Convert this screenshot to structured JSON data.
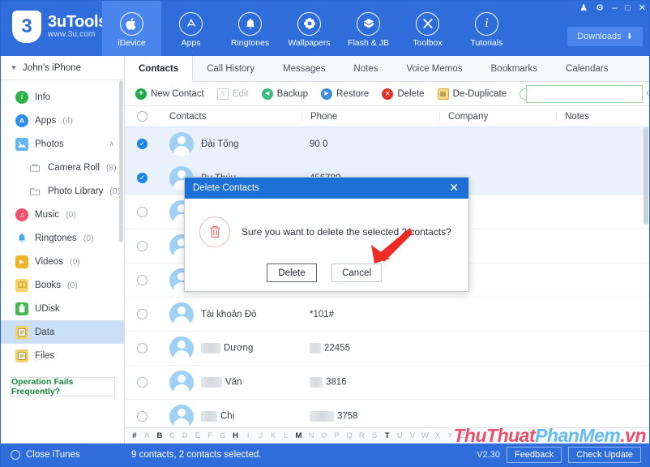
{
  "window": {
    "controls": [
      {
        "name": "skin-icon",
        "glyph": "♟"
      },
      {
        "name": "settings-gear-icon",
        "glyph": "⚙"
      },
      {
        "name": "minimize-icon",
        "glyph": "–"
      },
      {
        "name": "maximize-icon",
        "glyph": "□"
      },
      {
        "name": "close-icon",
        "glyph": "✕"
      }
    ]
  },
  "brand": {
    "mark": "3",
    "name": "3uTools",
    "url": "www.3u.com"
  },
  "topnav": {
    "items": [
      {
        "label": "iDevice",
        "icon": "apple-icon",
        "glyph": "",
        "active": true
      },
      {
        "label": "Apps",
        "icon": "appstore-icon",
        "glyph": "A",
        "active": false
      },
      {
        "label": "Ringtones",
        "icon": "bell-icon",
        "glyph": "🔔",
        "active": false
      },
      {
        "label": "Wallpapers",
        "icon": "flower-icon",
        "glyph": "✿",
        "active": false
      },
      {
        "label": "Flash & JB",
        "icon": "box-icon",
        "glyph": "⬇",
        "active": false
      },
      {
        "label": "Toolbox",
        "icon": "wrench-icon",
        "glyph": "⚒",
        "active": false
      },
      {
        "label": "Tutorials",
        "icon": "info-icon",
        "glyph": "i",
        "active": false
      }
    ],
    "downloads_label": "Downloads",
    "downloads_glyph": "⬇"
  },
  "sidebar": {
    "device": "John’s iPhone",
    "items": [
      {
        "label": "Info",
        "count": "",
        "icon": "info-icon",
        "glyph": "i",
        "color": "#2cb34a",
        "shape": "circle",
        "indent": 0,
        "selected": false,
        "chevron": ""
      },
      {
        "label": "Apps",
        "count": "(4)",
        "icon": "appstore-icon",
        "glyph": "A",
        "color": "#2f8ced",
        "shape": "circle",
        "indent": 0,
        "selected": false,
        "chevron": ""
      },
      {
        "label": "Photos",
        "count": "",
        "icon": "photos-icon",
        "glyph": "🏔",
        "color": "#64b5f6",
        "shape": "square",
        "indent": 0,
        "selected": false,
        "chevron": "∧"
      },
      {
        "label": "Camera Roll",
        "count": "(8)",
        "icon": "camera-roll-icon",
        "glyph": "□",
        "color": "#8a919b",
        "shape": "outline",
        "indent": 1,
        "selected": false,
        "chevron": ""
      },
      {
        "label": "Photo Library",
        "count": "(0)",
        "icon": "folder-icon",
        "glyph": "□",
        "color": "#8a919b",
        "shape": "outline",
        "indent": 1,
        "selected": false,
        "chevron": ""
      },
      {
        "label": "Music",
        "count": "(0)",
        "icon": "music-icon",
        "glyph": "♫",
        "color": "#f2506e",
        "shape": "circle",
        "indent": 0,
        "selected": false,
        "chevron": ""
      },
      {
        "label": "Ringtones",
        "count": "(0)",
        "icon": "bell-icon",
        "glyph": "🔔",
        "color": "#4aa8f0",
        "shape": "plain",
        "indent": 0,
        "selected": false,
        "chevron": ""
      },
      {
        "label": "Videos",
        "count": "(0)",
        "icon": "video-icon",
        "glyph": "▶",
        "color": "#f0b429",
        "shape": "square",
        "indent": 0,
        "selected": false,
        "chevron": ""
      },
      {
        "label": "Books",
        "count": "(0)",
        "icon": "books-icon",
        "glyph": "📖",
        "color": "#f5d26a",
        "shape": "square",
        "indent": 0,
        "selected": false,
        "chevron": ""
      },
      {
        "label": "UDisk",
        "count": "",
        "icon": "usb-icon",
        "glyph": "⚡",
        "color": "#3fb950",
        "shape": "square",
        "indent": 0,
        "selected": false,
        "chevron": ""
      },
      {
        "label": "Data",
        "count": "",
        "icon": "data-icon",
        "glyph": "☰",
        "color": "#f3cf6b",
        "shape": "square",
        "indent": 0,
        "selected": true,
        "chevron": ""
      },
      {
        "label": "Files",
        "count": "",
        "icon": "files-icon",
        "glyph": "☰",
        "color": "#f3cf6b",
        "shape": "square",
        "indent": 0,
        "selected": false,
        "chevron": ""
      }
    ],
    "operation_fails": "Operation Fails Frequently?"
  },
  "tabs": [
    {
      "label": "Contacts",
      "active": true
    },
    {
      "label": "Call History",
      "active": false
    },
    {
      "label": "Messages",
      "active": false
    },
    {
      "label": "Notes",
      "active": false
    },
    {
      "label": "Voice Memos",
      "active": false
    },
    {
      "label": "Bookmarks",
      "active": false
    },
    {
      "label": "Calendars",
      "active": false
    }
  ],
  "toolbar": {
    "buttons": [
      {
        "label": "New Contact",
        "icon": "plus-circle-icon",
        "glyph": "+",
        "color": "#23a94d",
        "shape": "circle",
        "disabled": false
      },
      {
        "label": "Edit",
        "icon": "pencil-icon",
        "glyph": "✎",
        "color": "#c3c8cf",
        "shape": "square",
        "disabled": true
      },
      {
        "label": "Backup",
        "icon": "backup-icon",
        "glyph": "◀",
        "color": "#3cba7d",
        "shape": "circle",
        "disabled": false
      },
      {
        "label": "Restore",
        "icon": "restore-icon",
        "glyph": "▶",
        "color": "#3f8ee0",
        "shape": "circle",
        "disabled": false
      },
      {
        "label": "Delete",
        "icon": "delete-icon",
        "glyph": "✕",
        "color": "#e0352f",
        "shape": "circle",
        "disabled": false
      },
      {
        "label": "De-Duplicate",
        "icon": "deduplicate-icon",
        "glyph": "▤",
        "color": "#f0c44a",
        "shape": "square",
        "disabled": false
      },
      {
        "label": "Refresh",
        "icon": "refresh-icon",
        "glyph": "↻",
        "color": "#8bd4a4",
        "shape": "circle",
        "disabled": false
      }
    ],
    "search_placeholder": "",
    "search_value": "",
    "search_icon": "magnifier-icon"
  },
  "table": {
    "columns": [
      "Contacts",
      "Phone",
      "Company",
      "Notes"
    ],
    "rows": [
      {
        "name": "Đài Tống",
        "name_blur": 0,
        "phone": "90 0",
        "phone_blur": 0,
        "company": "",
        "notes": "",
        "checked": true
      },
      {
        "name": "Bụ Thúy",
        "name_blur": 0,
        "phone": "456789",
        "phone_blur": 0,
        "company": "",
        "notes": "",
        "checked": true
      },
      {
        "name": "",
        "name_blur": 0,
        "phone": "",
        "phone_blur": 0,
        "company": "",
        "notes": "",
        "checked": false
      },
      {
        "name": "",
        "name_blur": 0,
        "phone": "",
        "phone_blur": 0,
        "company": "",
        "notes": "",
        "checked": false
      },
      {
        "name": "",
        "name_blur": 0,
        "phone": "",
        "phone_blur": 0,
        "company": "",
        "notes": "",
        "checked": false
      },
      {
        "name": "Tài khoản Đỏ",
        "name_blur": 0,
        "phone": "*101#",
        "phone_blur": 0,
        "company": "",
        "notes": "",
        "checked": false
      },
      {
        "name": "Dương",
        "name_blur": 24,
        "phone": "22455",
        "phone_blur": 14,
        "company": "",
        "notes": "",
        "checked": false
      },
      {
        "name": "Văn",
        "name_blur": 26,
        "phone": "3816",
        "phone_blur": 16,
        "company": "",
        "notes": "",
        "checked": false
      },
      {
        "name": "Chị",
        "name_blur": 20,
        "phone": "3758",
        "phone_blur": 30,
        "company": "",
        "notes": "",
        "checked": false
      }
    ]
  },
  "alphabet": {
    "letters": [
      "#",
      "A",
      "B",
      "C",
      "D",
      "E",
      "F",
      "G",
      "H",
      "I",
      "J",
      "K",
      "L",
      "M",
      "N",
      "O",
      "P",
      "Q",
      "R",
      "S",
      "T",
      "U",
      "V",
      "W",
      "X",
      "Y",
      "Z"
    ],
    "active": [
      "#",
      "B",
      "H",
      "M",
      "T"
    ]
  },
  "statusbar": {
    "close_itunes": "Close iTunes",
    "status": "9 contacts, 2 contacts selected.",
    "version": "V2.30",
    "feedback": "Feedback",
    "check_update": "Check Update"
  },
  "modal": {
    "title": "Delete Contacts",
    "close_glyph": "✕",
    "trash_icon": "trash-icon",
    "trash_glyph": "🗑",
    "message": "Sure you want to delete the selected 2 contacts?",
    "delete_label": "Delete",
    "cancel_label": "Cancel"
  },
  "watermark": {
    "part1": "ThuThuat",
    "part2": "PhanMem",
    "part3": ".vn"
  },
  "colors": {
    "brand_blue": "#2f6ddb",
    "accent_blue": "#1b84e7",
    "selected_row": "#e9f2fc",
    "green_border": "#9fd0a6",
    "danger_red": "#e0352f"
  }
}
